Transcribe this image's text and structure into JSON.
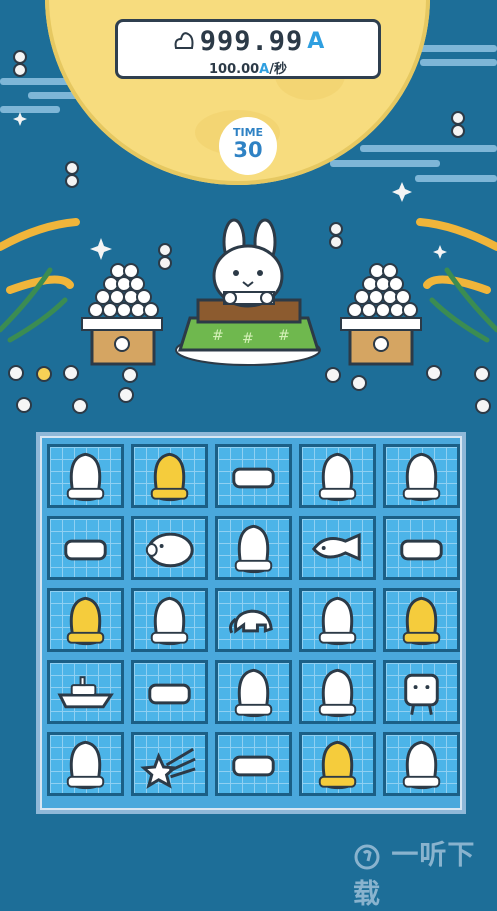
{
  "hud": {
    "score_value": "999.99",
    "score_unit": "A",
    "rate_value": "100.00",
    "rate_unit": "A",
    "rate_suffix": "/秒",
    "timer_label": "TIME",
    "timer_value": "30"
  },
  "board": {
    "rows": 5,
    "cols": 5,
    "cells": [
      [
        "ghost-white",
        "ghost-yellow",
        "mochi",
        "ghost-white",
        "ghost-white"
      ],
      [
        "mochi",
        "pig",
        "ghost-white",
        "taiyaki",
        "mochi"
      ],
      [
        "ghost-yellow",
        "ghost-white",
        "elephant",
        "ghost-white",
        "ghost-yellow"
      ],
      [
        "boat",
        "mochi",
        "ghost-white",
        "ghost-white",
        "toast-character"
      ],
      [
        "ghost-white",
        "shooting-star",
        "mochi",
        "ghost-yellow",
        "ghost-white"
      ]
    ]
  },
  "decor": [
    "moon",
    "rabbit-at-kotatsu",
    "dango-pyramid-left",
    "dango-pyramid-right",
    "rice-stalks-left",
    "rice-stalks-right"
  ],
  "watermark": {
    "icon": "ear-logo-icon",
    "text": "一听下载"
  },
  "colors": {
    "background": "#1d6e98",
    "moon": "#f7dc7e",
    "board": "#4cb4e8",
    "ghost_white": "#ffffff",
    "ghost_yellow": "#f5cc3c",
    "accent_blue": "#2f9fe0"
  }
}
